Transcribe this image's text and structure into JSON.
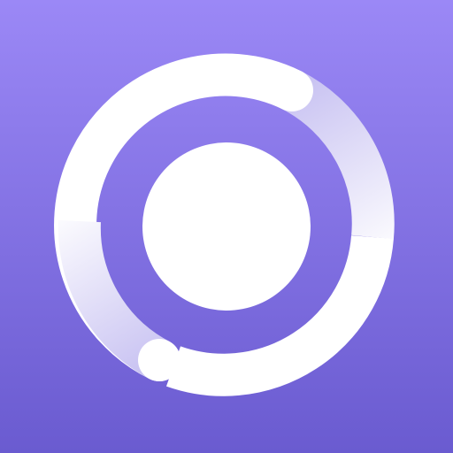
{
  "icon": {
    "name": "ring-progress-app-icon",
    "colors": {
      "background_top": "#9B88F6",
      "background_bottom": "#6A5BD0",
      "ring": "#FFFFFF",
      "ring_fade": "#C9C3F2",
      "center_dot": "#FFFFFF"
    }
  }
}
